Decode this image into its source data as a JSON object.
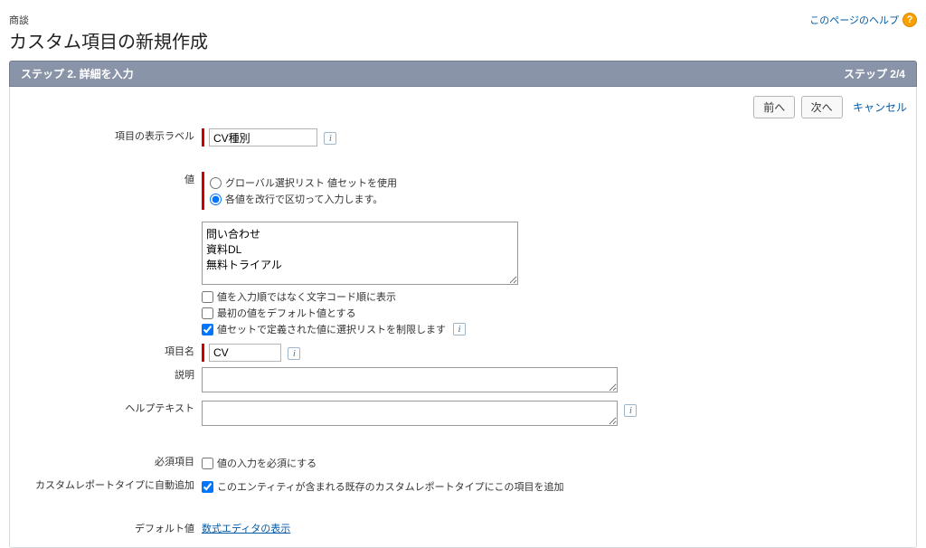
{
  "header": {
    "context": "商談",
    "title": "カスタム項目の新規作成",
    "help_link": "このページのヘルプ",
    "help_icon_glyph": "?"
  },
  "step_bar": {
    "left": "ステップ 2. 詳細を入力",
    "right": "ステップ 2/4"
  },
  "buttons": {
    "prev": "前へ",
    "next": "次へ",
    "cancel": "キャンセル"
  },
  "labels": {
    "field_label": "項目の表示ラベル",
    "values": "値",
    "field_name": "項目名",
    "description": "説明",
    "help_text": "ヘルプテキスト",
    "required": "必須項目",
    "auto_add_report": "カスタムレポートタイプに自動追加",
    "default_value": "デフォルト値"
  },
  "inputs": {
    "field_label_value": "CV種別",
    "field_name_value": "CV",
    "values_text": "問い合わせ\n資料DL\n無料トライアル",
    "description_value": "",
    "help_text_value": ""
  },
  "value_options": {
    "radio_global": "グローバル選択リスト 値セットを使用",
    "radio_each": "各値を改行で区切って入力します。",
    "sort_label": "値を入力順ではなく文字コード順に表示",
    "first_default_label": "最初の値をデフォルト値とする",
    "restrict_label": "値セットで定義された値に選択リストを制限します"
  },
  "required_checkbox_label": "値の入力を必須にする",
  "auto_add_report_label": "このエンティティが含まれる既存のカスタムレポートタイプにこの項目を追加",
  "default_value_link": "数式エディタの表示",
  "info_glyph": "i"
}
